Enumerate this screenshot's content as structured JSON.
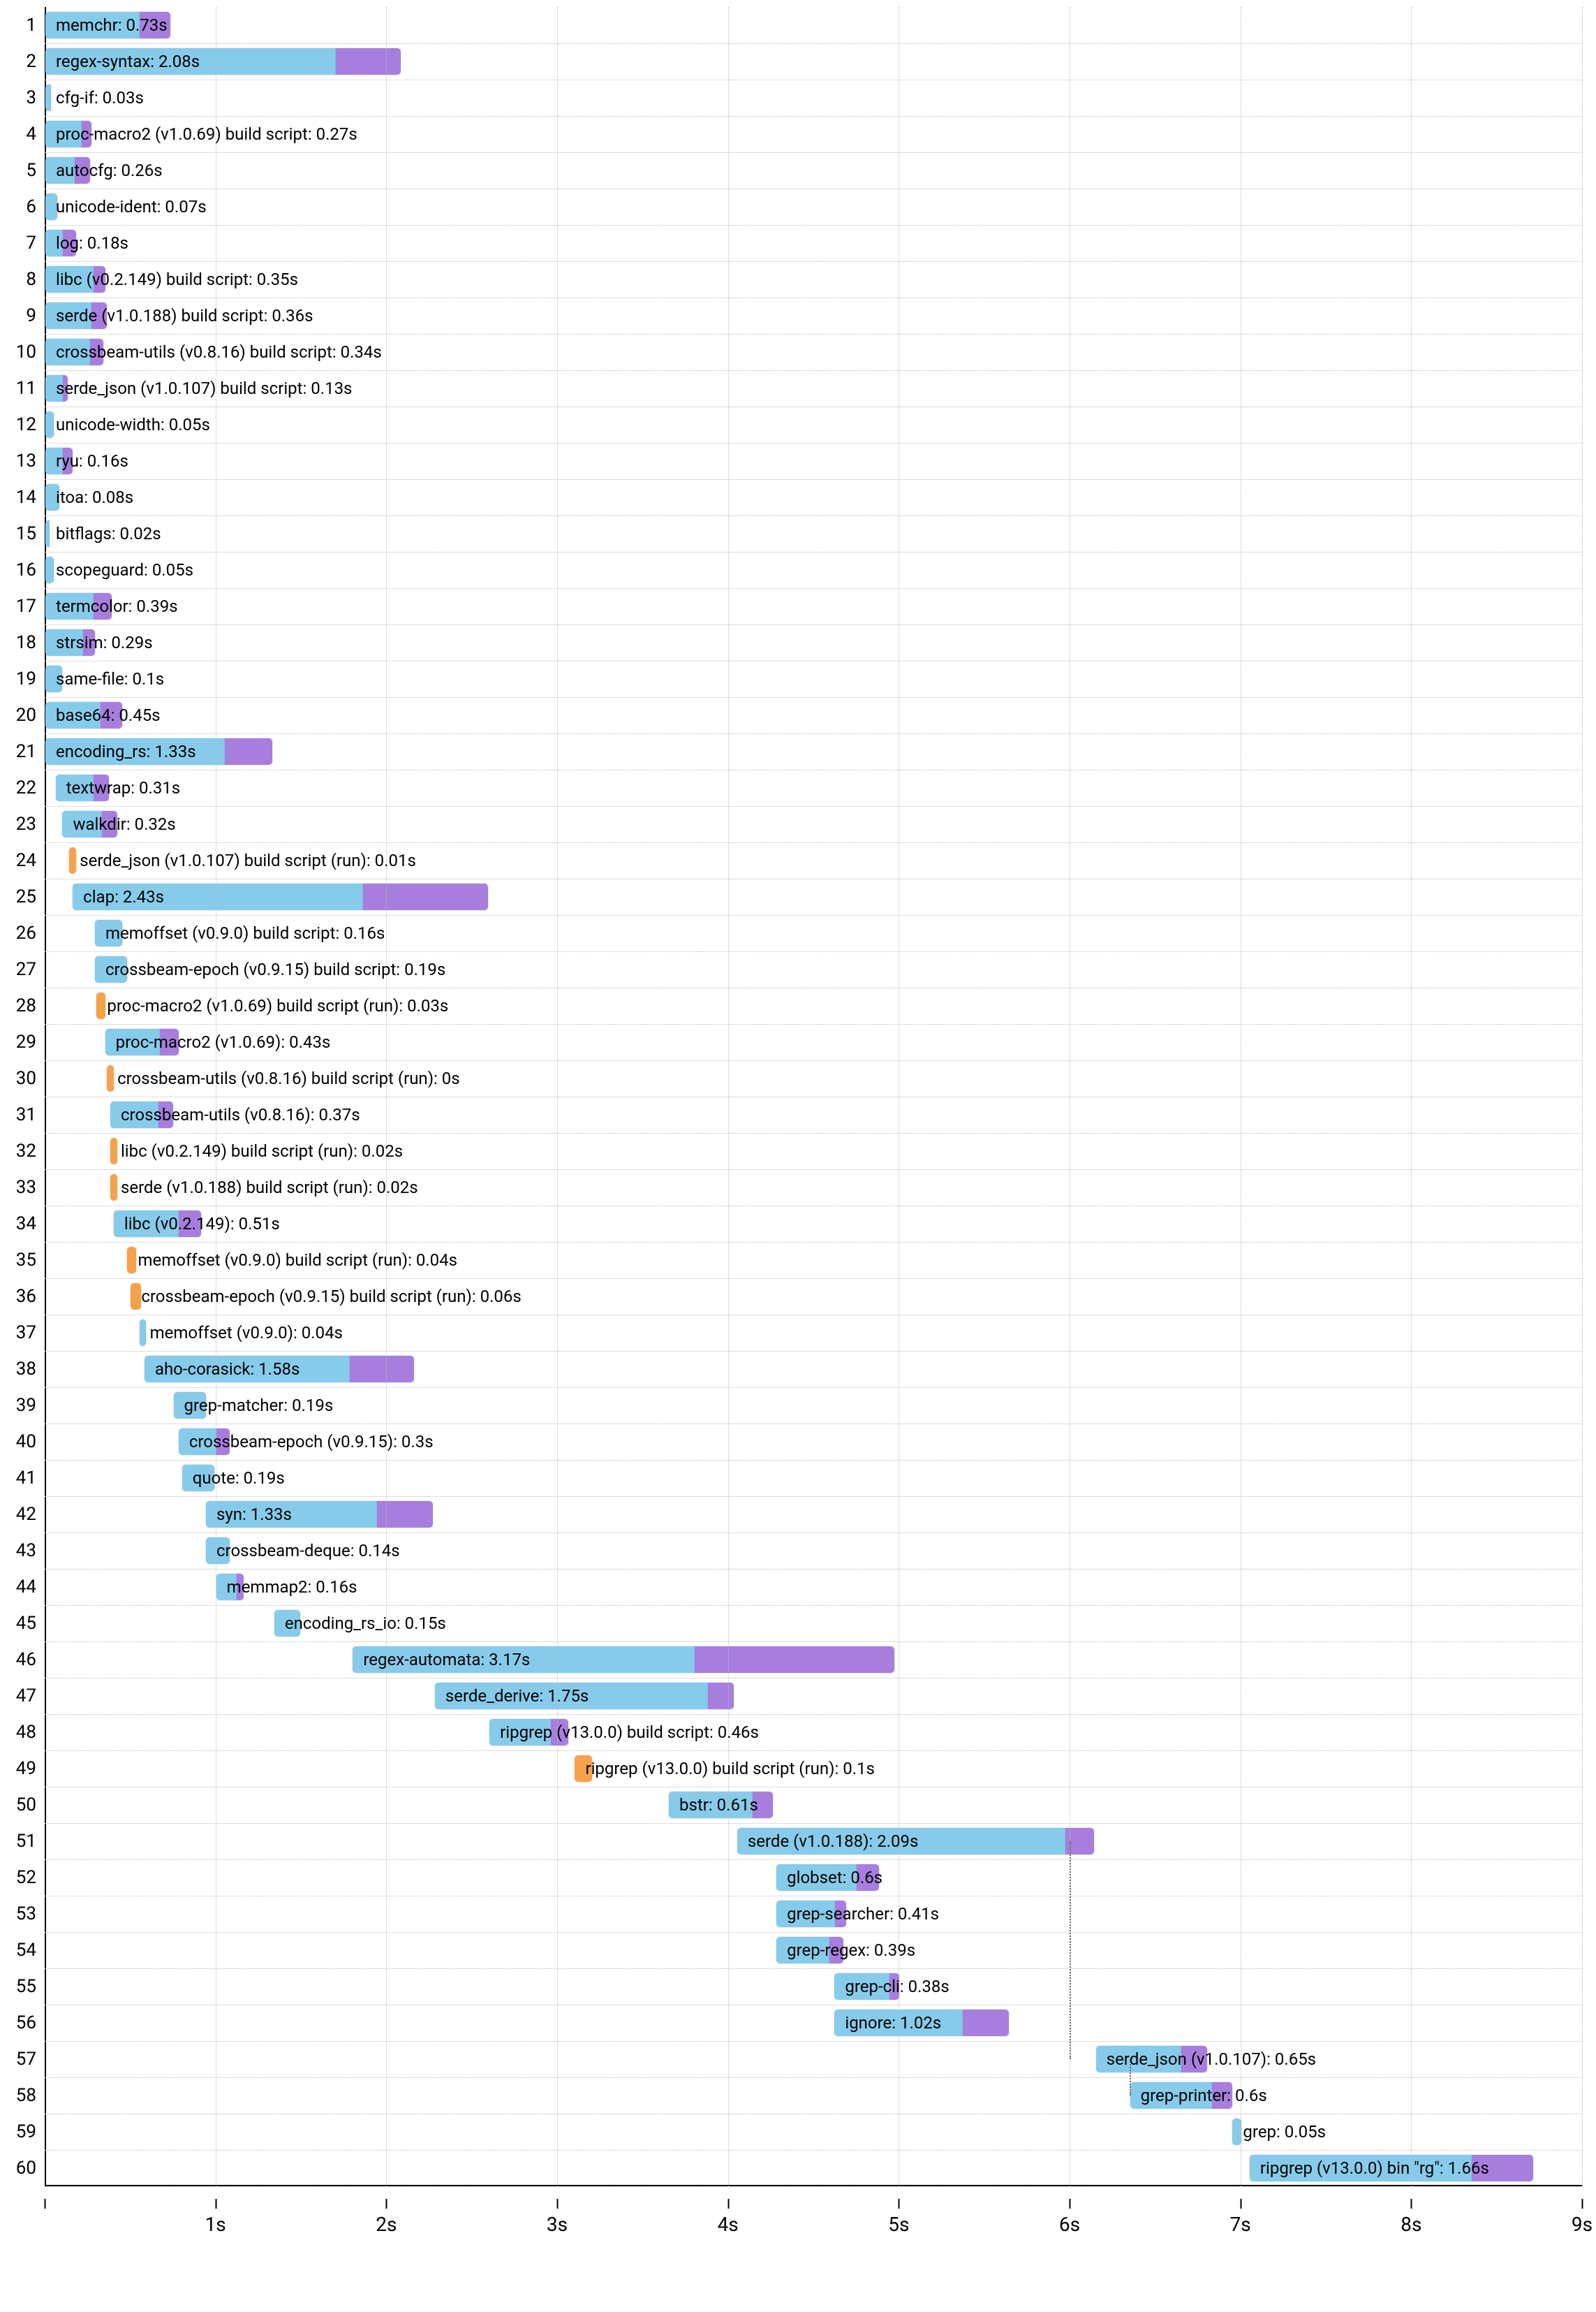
{
  "chart_data": {
    "type": "gantt",
    "x_unit": "seconds",
    "x_max": 9.0,
    "x_ticks": [
      0,
      1,
      2,
      3,
      4,
      5,
      6,
      7,
      8,
      9
    ],
    "x_tick_labels": [
      "",
      "1s",
      "2s",
      "3s",
      "4s",
      "5s",
      "6s",
      "7s",
      "8s",
      "9s"
    ],
    "colors": {
      "blue": "#87cbea",
      "purple": "#a77ede",
      "orange": "#f7a24a"
    },
    "rows": [
      {
        "n": 1,
        "label": "memchr: 0.73s",
        "start": 0.0,
        "segs": [
          [
            "blue",
            0.55
          ],
          [
            "purple",
            0.18
          ]
        ]
      },
      {
        "n": 2,
        "label": "regex-syntax: 2.08s",
        "start": 0.0,
        "segs": [
          [
            "blue",
            1.7
          ],
          [
            "purple",
            0.38
          ]
        ]
      },
      {
        "n": 3,
        "label": "cfg-if: 0.03s",
        "start": 0.0,
        "segs": [
          [
            "blue",
            0.03
          ]
        ]
      },
      {
        "n": 4,
        "label": "proc-macro2 (v1.0.69) build script: 0.27s",
        "start": 0.0,
        "segs": [
          [
            "blue",
            0.21
          ],
          [
            "purple",
            0.06
          ]
        ]
      },
      {
        "n": 5,
        "label": "autocfg: 0.26s",
        "start": 0.0,
        "segs": [
          [
            "blue",
            0.17
          ],
          [
            "purple",
            0.09
          ]
        ]
      },
      {
        "n": 6,
        "label": "unicode-ident: 0.07s",
        "start": 0.0,
        "segs": [
          [
            "blue",
            0.07
          ]
        ]
      },
      {
        "n": 7,
        "label": "log: 0.18s",
        "start": 0.0,
        "segs": [
          [
            "blue",
            0.1
          ],
          [
            "purple",
            0.08
          ]
        ]
      },
      {
        "n": 8,
        "label": "libc (v0.2.149) build script: 0.35s",
        "start": 0.0,
        "segs": [
          [
            "blue",
            0.28
          ],
          [
            "purple",
            0.07
          ]
        ]
      },
      {
        "n": 9,
        "label": "serde (v1.0.188) build script: 0.36s",
        "start": 0.0,
        "segs": [
          [
            "blue",
            0.27
          ],
          [
            "purple",
            0.09
          ]
        ]
      },
      {
        "n": 10,
        "label": "crossbeam-utils (v0.8.16) build script: 0.34s",
        "start": 0.0,
        "segs": [
          [
            "blue",
            0.26
          ],
          [
            "purple",
            0.08
          ]
        ]
      },
      {
        "n": 11,
        "label": "serde_json (v1.0.107) build script: 0.13s",
        "start": 0.0,
        "segs": [
          [
            "blue",
            0.1
          ],
          [
            "purple",
            0.03
          ]
        ]
      },
      {
        "n": 12,
        "label": "unicode-width: 0.05s",
        "start": 0.0,
        "segs": [
          [
            "blue",
            0.05
          ]
        ]
      },
      {
        "n": 13,
        "label": "ryu: 0.16s",
        "start": 0.0,
        "segs": [
          [
            "blue",
            0.1
          ],
          [
            "purple",
            0.06
          ]
        ]
      },
      {
        "n": 14,
        "label": "itoa: 0.08s",
        "start": 0.0,
        "segs": [
          [
            "blue",
            0.08
          ]
        ]
      },
      {
        "n": 15,
        "label": "bitflags: 0.02s",
        "start": 0.0,
        "segs": [
          [
            "blue",
            0.02
          ]
        ]
      },
      {
        "n": 16,
        "label": "scopeguard: 0.05s",
        "start": 0.0,
        "segs": [
          [
            "blue",
            0.05
          ]
        ]
      },
      {
        "n": 17,
        "label": "termcolor: 0.39s",
        "start": 0.0,
        "segs": [
          [
            "blue",
            0.28
          ],
          [
            "purple",
            0.11
          ]
        ]
      },
      {
        "n": 18,
        "label": "strsim: 0.29s",
        "start": 0.0,
        "segs": [
          [
            "blue",
            0.22
          ],
          [
            "purple",
            0.07
          ]
        ]
      },
      {
        "n": 19,
        "label": "same-file: 0.1s",
        "start": 0.0,
        "segs": [
          [
            "blue",
            0.1
          ]
        ]
      },
      {
        "n": 20,
        "label": "base64: 0.45s",
        "start": 0.0,
        "segs": [
          [
            "blue",
            0.32
          ],
          [
            "purple",
            0.13
          ]
        ]
      },
      {
        "n": 21,
        "label": "encoding_rs: 1.33s",
        "start": 0.0,
        "segs": [
          [
            "blue",
            1.05
          ],
          [
            "purple",
            0.28
          ]
        ]
      },
      {
        "n": 22,
        "label": "textwrap: 0.31s",
        "start": 0.06,
        "segs": [
          [
            "blue",
            0.22
          ],
          [
            "purple",
            0.09
          ]
        ]
      },
      {
        "n": 23,
        "label": "walkdir: 0.32s",
        "start": 0.1,
        "segs": [
          [
            "blue",
            0.23
          ],
          [
            "purple",
            0.09
          ]
        ]
      },
      {
        "n": 24,
        "label": "serde_json (v1.0.107) build script (run): 0.01s",
        "start": 0.14,
        "segs": [
          [
            "orange",
            0.04
          ]
        ]
      },
      {
        "n": 25,
        "label": "clap: 2.43s",
        "start": 0.16,
        "segs": [
          [
            "blue",
            1.7
          ],
          [
            "purple",
            0.73
          ]
        ]
      },
      {
        "n": 26,
        "label": "memoffset (v0.9.0) build script: 0.16s",
        "start": 0.29,
        "segs": [
          [
            "blue",
            0.16
          ]
        ]
      },
      {
        "n": 27,
        "label": "crossbeam-epoch (v0.9.15) build script: 0.19s",
        "start": 0.29,
        "segs": [
          [
            "blue",
            0.19
          ]
        ]
      },
      {
        "n": 28,
        "label": "proc-macro2 (v1.0.69) build script (run): 0.03s",
        "start": 0.3,
        "segs": [
          [
            "orange",
            0.05
          ]
        ]
      },
      {
        "n": 29,
        "label": "proc-macro2 (v1.0.69): 0.43s",
        "start": 0.35,
        "segs": [
          [
            "blue",
            0.32
          ],
          [
            "purple",
            0.11
          ]
        ]
      },
      {
        "n": 30,
        "label": "crossbeam-utils (v0.8.16) build script (run): 0s",
        "start": 0.36,
        "segs": [
          [
            "orange",
            0.04
          ]
        ]
      },
      {
        "n": 31,
        "label": "crossbeam-utils (v0.8.16): 0.37s",
        "start": 0.38,
        "segs": [
          [
            "blue",
            0.28
          ],
          [
            "purple",
            0.09
          ]
        ]
      },
      {
        "n": 32,
        "label": "libc (v0.2.149) build script (run): 0.02s",
        "start": 0.38,
        "segs": [
          [
            "orange",
            0.04
          ]
        ]
      },
      {
        "n": 33,
        "label": "serde (v1.0.188) build script (run): 0.02s",
        "start": 0.38,
        "segs": [
          [
            "orange",
            0.04
          ]
        ]
      },
      {
        "n": 34,
        "label": "libc (v0.2.149): 0.51s",
        "start": 0.4,
        "segs": [
          [
            "blue",
            0.38
          ],
          [
            "purple",
            0.13
          ]
        ]
      },
      {
        "n": 35,
        "label": "memoffset (v0.9.0) build script (run): 0.04s",
        "start": 0.48,
        "segs": [
          [
            "orange",
            0.05
          ]
        ]
      },
      {
        "n": 36,
        "label": "crossbeam-epoch (v0.9.15) build script (run): 0.06s",
        "start": 0.5,
        "segs": [
          [
            "orange",
            0.06
          ]
        ]
      },
      {
        "n": 37,
        "label": "memoffset (v0.9.0): 0.04s",
        "start": 0.55,
        "segs": [
          [
            "blue",
            0.04
          ]
        ]
      },
      {
        "n": 38,
        "label": "aho-corasick: 1.58s",
        "start": 0.58,
        "segs": [
          [
            "blue",
            1.2
          ],
          [
            "purple",
            0.38
          ]
        ]
      },
      {
        "n": 39,
        "label": "grep-matcher: 0.19s",
        "start": 0.75,
        "segs": [
          [
            "blue",
            0.19
          ]
        ]
      },
      {
        "n": 40,
        "label": "crossbeam-epoch (v0.9.15): 0.3s",
        "start": 0.78,
        "segs": [
          [
            "blue",
            0.22
          ],
          [
            "purple",
            0.08
          ]
        ]
      },
      {
        "n": 41,
        "label": "quote: 0.19s",
        "start": 0.8,
        "segs": [
          [
            "blue",
            0.19
          ]
        ]
      },
      {
        "n": 42,
        "label": "syn: 1.33s",
        "start": 0.94,
        "segs": [
          [
            "blue",
            1.0
          ],
          [
            "purple",
            0.33
          ]
        ]
      },
      {
        "n": 43,
        "label": "crossbeam-deque: 0.14s",
        "start": 0.94,
        "segs": [
          [
            "blue",
            0.14
          ]
        ]
      },
      {
        "n": 44,
        "label": "memmap2: 0.16s",
        "start": 1.0,
        "segs": [
          [
            "blue",
            0.12
          ],
          [
            "purple",
            0.04
          ]
        ]
      },
      {
        "n": 45,
        "label": "encoding_rs_io: 0.15s",
        "start": 1.34,
        "segs": [
          [
            "blue",
            0.15
          ]
        ]
      },
      {
        "n": 46,
        "label": "regex-automata: 3.17s",
        "start": 1.8,
        "segs": [
          [
            "blue",
            2.0
          ],
          [
            "purple",
            1.17
          ]
        ]
      },
      {
        "n": 47,
        "label": "serde_derive: 1.75s",
        "start": 2.28,
        "segs": [
          [
            "blue",
            1.6
          ],
          [
            "purple",
            0.15
          ]
        ]
      },
      {
        "n": 48,
        "label": "ripgrep (v13.0.0) build script: 0.46s",
        "start": 2.6,
        "segs": [
          [
            "blue",
            0.36
          ],
          [
            "purple",
            0.1
          ]
        ]
      },
      {
        "n": 49,
        "label": "ripgrep (v13.0.0) build script (run): 0.1s",
        "start": 3.1,
        "segs": [
          [
            "orange",
            0.1
          ]
        ]
      },
      {
        "n": 50,
        "label": "bstr: 0.61s",
        "start": 3.65,
        "segs": [
          [
            "blue",
            0.49
          ],
          [
            "purple",
            0.12
          ]
        ]
      },
      {
        "n": 51,
        "label": "serde (v1.0.188): 2.09s",
        "start": 4.05,
        "segs": [
          [
            "blue",
            1.92
          ],
          [
            "purple",
            0.17
          ]
        ]
      },
      {
        "n": 52,
        "label": "globset: 0.6s",
        "start": 4.28,
        "segs": [
          [
            "blue",
            0.47
          ],
          [
            "purple",
            0.13
          ]
        ]
      },
      {
        "n": 53,
        "label": "grep-searcher: 0.41s",
        "start": 4.28,
        "segs": [
          [
            "blue",
            0.34
          ],
          [
            "purple",
            0.07
          ]
        ]
      },
      {
        "n": 54,
        "label": "grep-regex: 0.39s",
        "start": 4.28,
        "segs": [
          [
            "blue",
            0.31
          ],
          [
            "purple",
            0.08
          ]
        ]
      },
      {
        "n": 55,
        "label": "grep-cli: 0.38s",
        "start": 4.62,
        "segs": [
          [
            "blue",
            0.32
          ],
          [
            "purple",
            0.06
          ]
        ]
      },
      {
        "n": 56,
        "label": "ignore: 1.02s",
        "start": 4.62,
        "segs": [
          [
            "blue",
            0.75
          ],
          [
            "purple",
            0.27
          ]
        ]
      },
      {
        "n": 57,
        "label": "serde_json (v1.0.107): 0.65s",
        "start": 6.15,
        "segs": [
          [
            "blue",
            0.5
          ],
          [
            "purple",
            0.15
          ]
        ]
      },
      {
        "n": 58,
        "label": "grep-printer: 0.6s",
        "start": 6.35,
        "segs": [
          [
            "blue",
            0.48
          ],
          [
            "purple",
            0.12
          ]
        ]
      },
      {
        "n": 59,
        "label": "grep: 0.05s",
        "start": 6.95,
        "segs": [
          [
            "blue",
            0.05
          ]
        ]
      },
      {
        "n": 60,
        "label": "ripgrep (v13.0.0) bin \"rg\": 1.66s",
        "start": 7.05,
        "segs": [
          [
            "blue",
            1.3
          ],
          [
            "purple",
            0.36
          ]
        ]
      }
    ]
  }
}
